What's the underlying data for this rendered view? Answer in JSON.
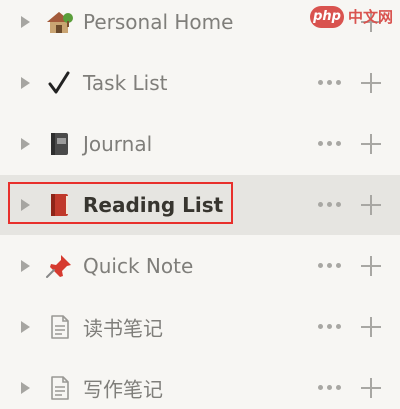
{
  "sidebar": {
    "items": [
      {
        "label": "Personal Home",
        "icon": "house-icon",
        "selected": false
      },
      {
        "label": "Task List",
        "icon": "checkmark-icon",
        "selected": false
      },
      {
        "label": "Journal",
        "icon": "notebook-icon",
        "selected": false
      },
      {
        "label": "Reading List",
        "icon": "red-book-icon",
        "selected": true
      },
      {
        "label": "Quick Note",
        "icon": "pushpin-icon",
        "selected": false
      },
      {
        "label": "读书笔记",
        "icon": "page-icon",
        "selected": false
      },
      {
        "label": "写作笔记",
        "icon": "page-icon",
        "selected": false
      }
    ],
    "more_icon": "more-horizontal-icon",
    "add_icon": "plus-icon",
    "toggle_icon": "triangle-right-icon"
  },
  "highlight_color": "#e8302c",
  "watermark": {
    "badge": "php",
    "text": "中文网",
    "color": "#d9534f"
  }
}
